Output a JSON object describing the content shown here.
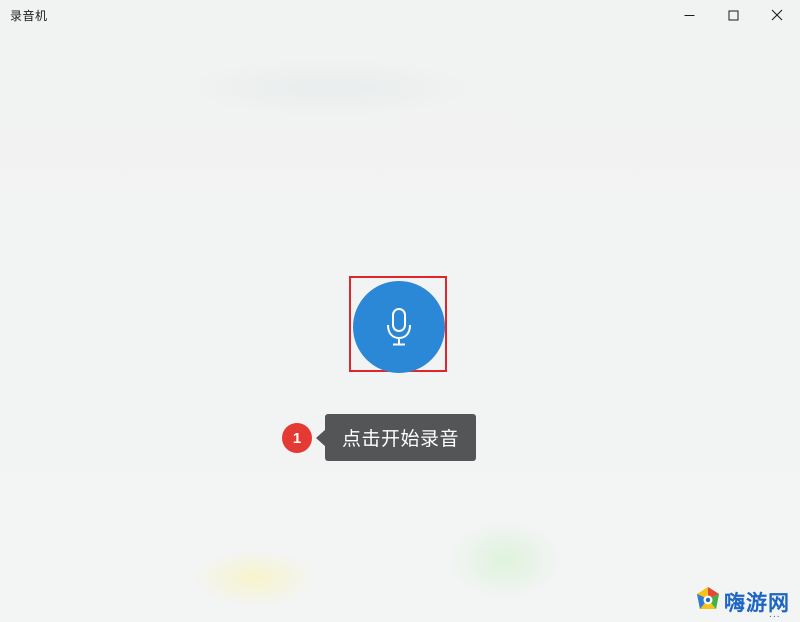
{
  "window": {
    "title": "录音机",
    "controls": {
      "minimize_icon": "minimize-icon",
      "maximize_icon": "maximize-icon",
      "close_icon": "close-icon"
    }
  },
  "main": {
    "record_button": {
      "icon": "microphone-icon",
      "color": "#2b88d6"
    },
    "highlight_color": "#e0262c"
  },
  "annotation": {
    "step_number": "1",
    "step_color": "#e53a33",
    "tooltip_text": "点击开始录音",
    "tooltip_color": "#545557"
  },
  "watermark": {
    "text": "嗨游网",
    "dots": "...",
    "color": "#1e66c4"
  }
}
